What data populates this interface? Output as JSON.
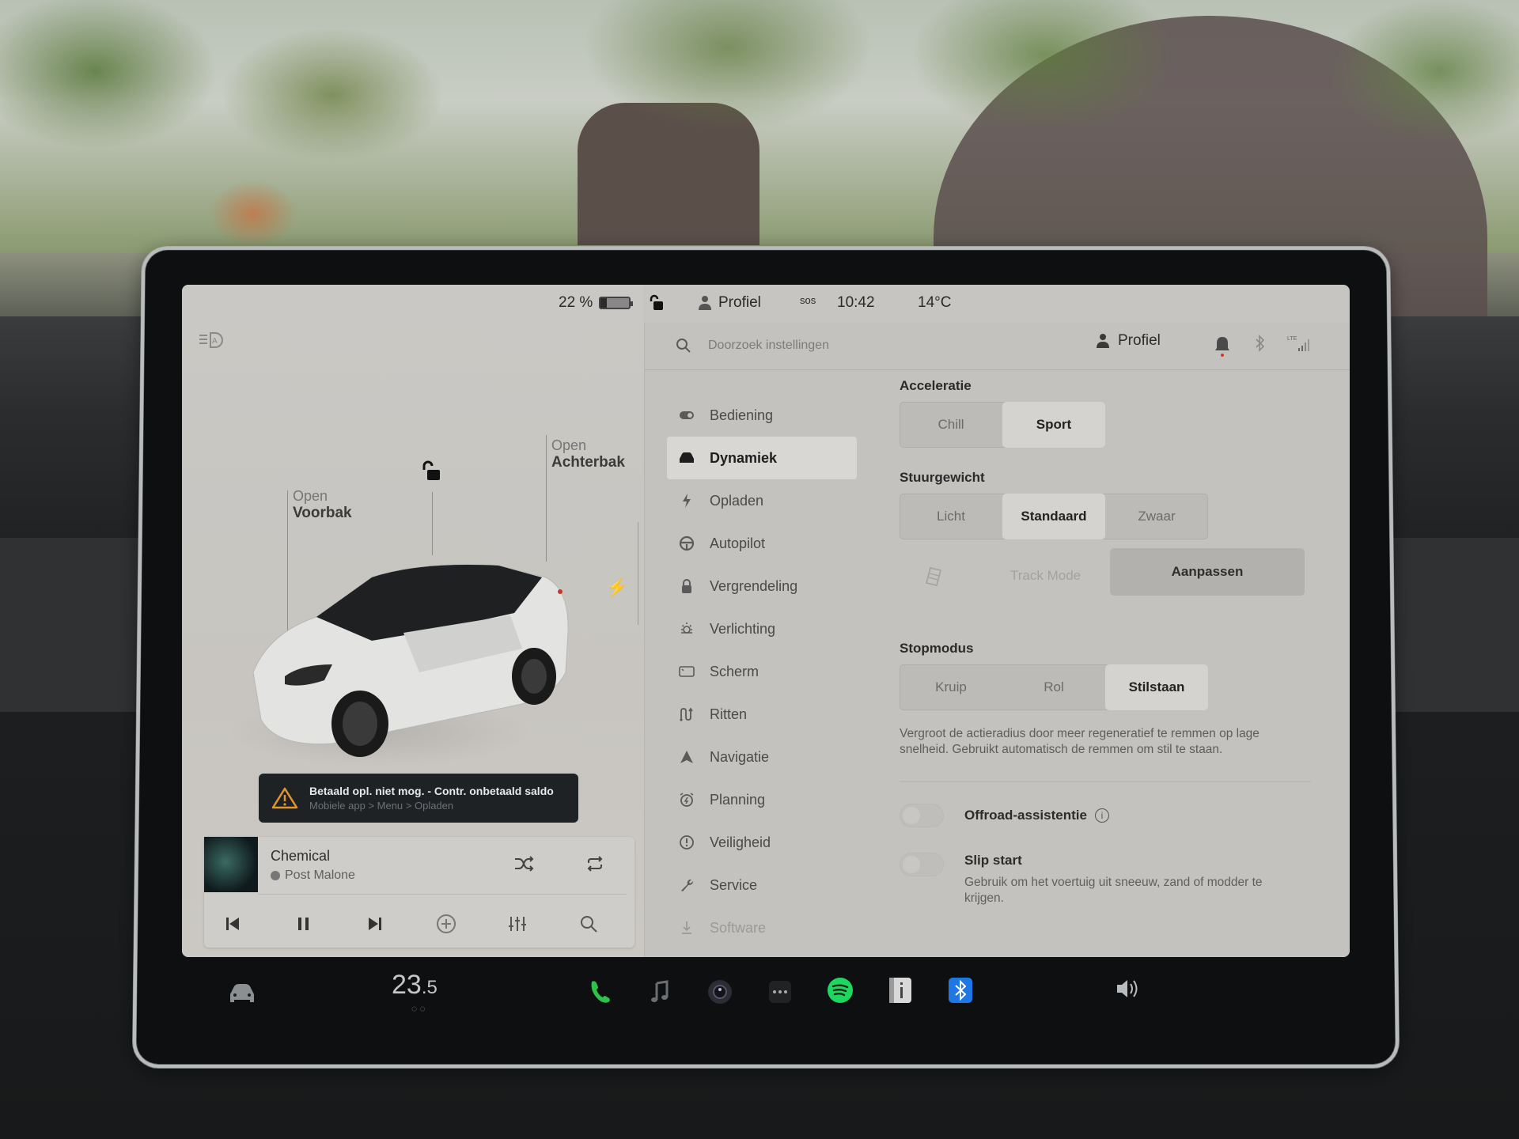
{
  "status_bar": {
    "battery_percent_label": "22 %",
    "battery_level": 0.22,
    "lock_state_icon": "unlocked-padlock-icon",
    "profile_label": "Profiel",
    "sos_label": "sos",
    "time": "10:42",
    "temperature": "14°C"
  },
  "car_panel": {
    "headlight_icon": "auto-headlight-icon",
    "frunk": {
      "state": "Open",
      "name": "Voorbak"
    },
    "trunk": {
      "state": "Open",
      "name": "Achterbak"
    },
    "charge_icon": "lightning-icon",
    "alert": {
      "title": "Betaald opl. niet mog. - Contr. onbetaald saldo",
      "subtitle": "Mobiele app > Menu > Opladen",
      "color": "#e0962e"
    }
  },
  "media": {
    "title": "Chemical",
    "artist": "Post Malone",
    "buttons": [
      "shuffle",
      "repeat",
      "previous",
      "pause",
      "next",
      "add",
      "equalizer",
      "search"
    ]
  },
  "settings": {
    "search_placeholder": "Doorzoek instellingen",
    "profile_label": "Profiel",
    "nav": [
      {
        "label": "Bediening",
        "icon": "toggle-icon",
        "active": false
      },
      {
        "label": "Dynamiek",
        "icon": "car-icon",
        "active": true
      },
      {
        "label": "Opladen",
        "icon": "lightning-icon",
        "active": false
      },
      {
        "label": "Autopilot",
        "icon": "steering-wheel-icon",
        "active": false
      },
      {
        "label": "Vergrendeling",
        "icon": "lock-icon",
        "active": false
      },
      {
        "label": "Verlichting",
        "icon": "sun-icon",
        "active": false
      },
      {
        "label": "Scherm",
        "icon": "display-icon",
        "active": false
      },
      {
        "label": "Ritten",
        "icon": "trips-icon",
        "active": false
      },
      {
        "label": "Navigatie",
        "icon": "navigation-arrow-icon",
        "active": false
      },
      {
        "label": "Planning",
        "icon": "alarm-clock-icon",
        "active": false
      },
      {
        "label": "Veiligheid",
        "icon": "alert-circle-icon",
        "active": false
      },
      {
        "label": "Service",
        "icon": "wrench-icon",
        "active": false
      },
      {
        "label": "Software",
        "icon": "download-icon",
        "active": false
      }
    ],
    "acceleratie": {
      "label": "Acceleratie",
      "options": [
        "Chill",
        "Sport"
      ],
      "selected": "Sport"
    },
    "stuurgewicht": {
      "label": "Stuurgewicht",
      "options": [
        "Licht",
        "Standaard",
        "Zwaar"
      ],
      "selected": "Standaard"
    },
    "track_mode": {
      "label": "Track Mode",
      "button": "Aanpassen"
    },
    "stopmodus": {
      "label": "Stopmodus",
      "options": [
        "Kruip",
        "Rol",
        "Stilstaan"
      ],
      "selected": "Stilstaan",
      "description": "Vergroot de actieradius door meer regeneratief te remmen op lage snelheid. Gebruikt automatisch de remmen om stil te staan."
    },
    "offroad": {
      "label": "Offroad-assistentie",
      "enabled": false
    },
    "slip_start": {
      "label": "Slip start",
      "description": "Gebruik om het voertuig uit sneeuw, zand of modder te krijgen.",
      "enabled": false
    }
  },
  "dock": {
    "temperature_main": "23",
    "temperature_decimal": ".5",
    "apps": [
      {
        "name": "phone",
        "color": "#2fc24b"
      },
      {
        "name": "music",
        "color": "#6c6f72"
      },
      {
        "name": "camera",
        "color": "#3a3a44"
      },
      {
        "name": "more",
        "color": "#8a8d90"
      },
      {
        "name": "spotify",
        "color": "#1ed760"
      },
      {
        "name": "manual",
        "color": "#d8d8d8"
      },
      {
        "name": "bluetooth",
        "color": "#1f77e5"
      }
    ],
    "volume_icon": "speaker-icon"
  }
}
